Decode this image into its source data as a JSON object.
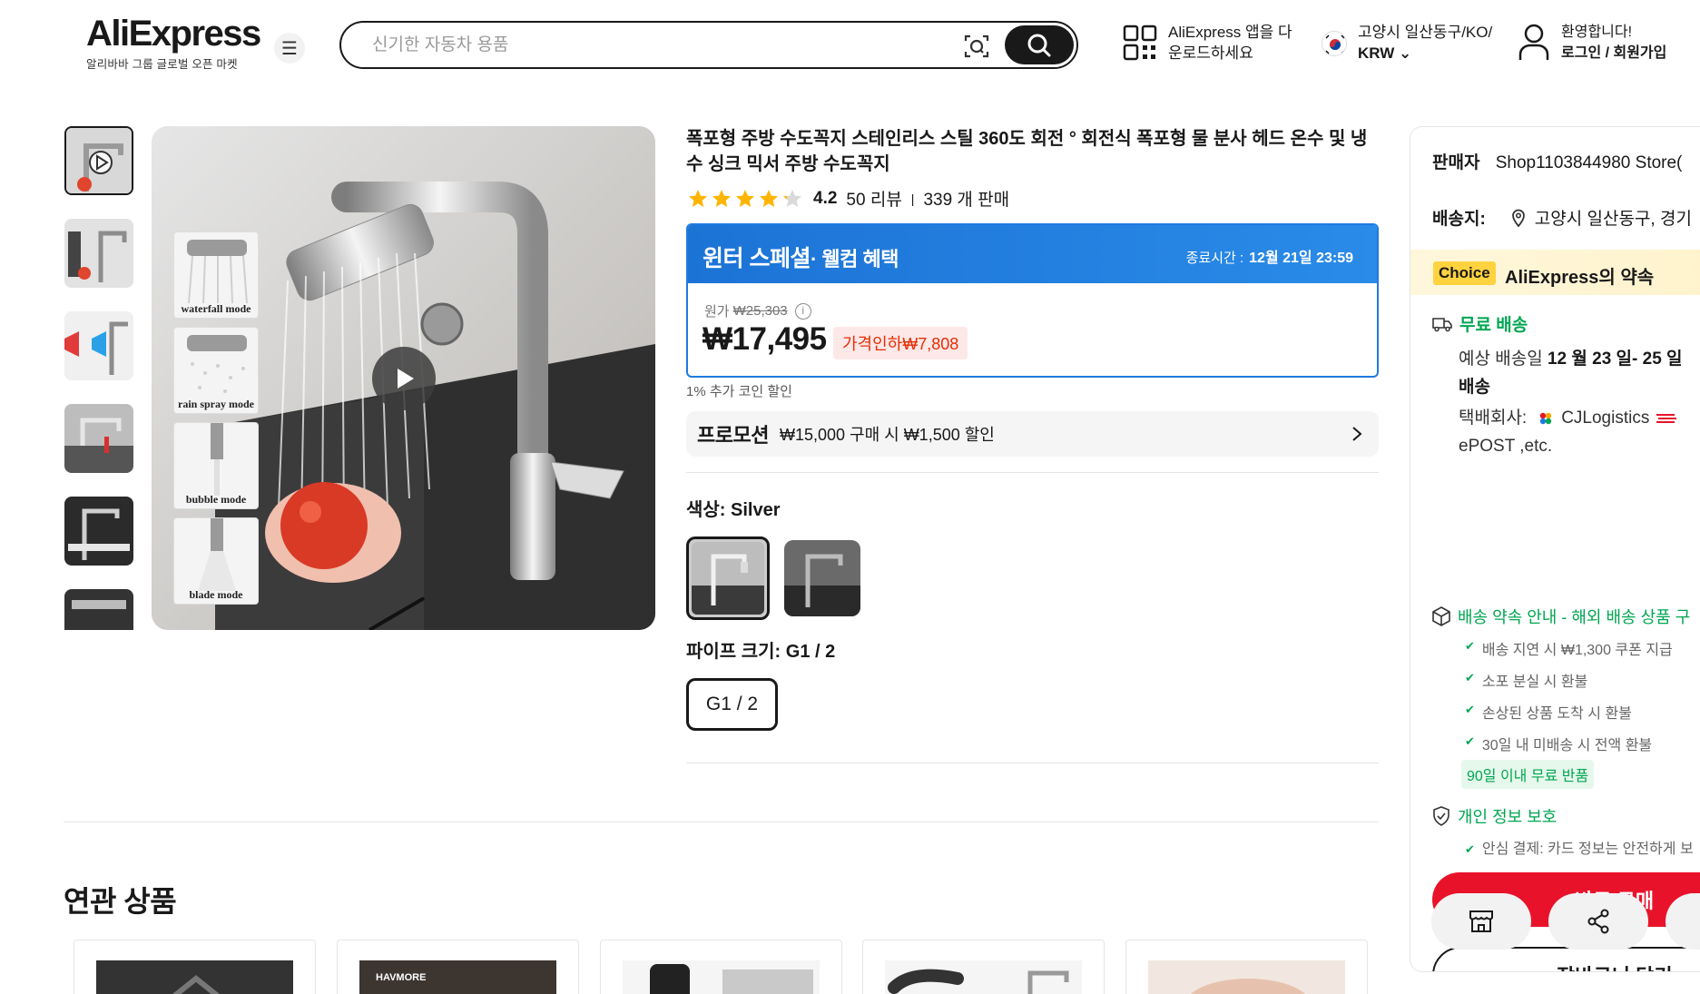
{
  "header": {
    "logo_main": "AliExpress",
    "logo_sub": "알리바바 그룹 글로벌 오픈 마켓",
    "search_placeholder": "신기한 자동차 용품",
    "app_download": "AliExpress 앱을 다운로드하세요",
    "region": "고양시 일산동구/KO/",
    "currency": "KRW",
    "welcome": "환영합니다!",
    "login": "로그인 / 회원가입"
  },
  "gallery": {
    "modes": [
      "waterfall mode",
      "rain spray mode",
      "bubble mode",
      "blade mode"
    ]
  },
  "product": {
    "title": "폭포형 주방 수도꼭지 스테인리스 스틸 360도 회전 ° 회전식 폭포형 물 분사 헤드 온수 및 냉수 싱크 믹서 주방 수도꼭지",
    "rating": "4.2",
    "rating_value": 4.2,
    "reviews": "50 리뷰",
    "sold": "339 개 판매",
    "promo_name": "윈터 스페셜",
    "promo_sub": "· 웰컴 혜택",
    "end_label": "종료시간 :",
    "end_time": "12월 21일 23:59",
    "orig_label": "원가",
    "orig_price": "₩25,303",
    "price": "₩17,495",
    "discount": "가격인하₩7,808",
    "coin_note": "1% 추가 코인 할인",
    "promotion_label": "프로모션",
    "promotion_text": "₩15,000 구매 시 ₩1,500 할인",
    "color_label": "색상: Silver",
    "pipe_label": "파이프 크기: G1 / 2",
    "pipe_option": "G1 / 2"
  },
  "related": {
    "title": "연관 상품",
    "brand_text": "HAVMORE"
  },
  "panel": {
    "seller_label": "판매자",
    "seller": "Shop1103844980 Store(",
    "ship_to_label": "배송지:",
    "ship_to": "고양시 일산동구, 경기",
    "choice_badge": "Choice",
    "choice_text": "AliExpress의 약속",
    "free_shipping": "무료 배송",
    "est_label": "예상 배송일",
    "est_date": "12 월 23 일- 25 일",
    "est_suffix": "배송",
    "carrier_label": "택배회사:",
    "carrier": "CJLogistics",
    "carrier2": "ePOST ,etc.",
    "guarantee_title": "배송 약속 안내 - 해외 배송 상품 구",
    "guarantees": [
      "배송 지연 시 ₩1,300 쿠폰 지급",
      "소포 분실 시 환불",
      "손상된 상품 도착 시 환불",
      "30일 내 미배송 시 전액 환불"
    ],
    "return_badge": "90일 이내 무료 반품",
    "privacy_title": "개인 정보 보호",
    "privacy_item": "안심 결제: 카드 정보는 안전하게 보",
    "buy_now": "바로 구매",
    "add_cart": "장바구니 담기"
  },
  "colors": {
    "accent_red": "#e8132b",
    "promo_blue": "#1f7ae0",
    "green": "#00a651",
    "star": "#ffb400"
  }
}
